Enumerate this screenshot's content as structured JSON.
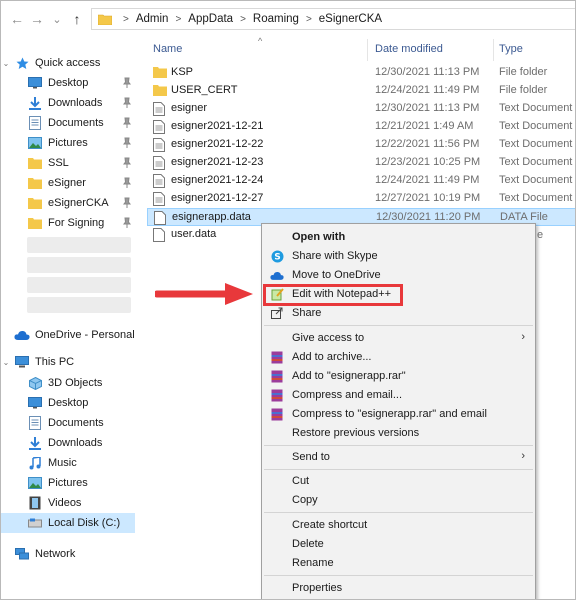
{
  "breadcrumb": [
    "Admin",
    "AppData",
    "Roaming",
    "eSignerCKA"
  ],
  "nav": {
    "back": "←",
    "forward": "→",
    "recent": "⌄",
    "up": "↑"
  },
  "sidebar": {
    "quick_access": "Quick access",
    "pinned": [
      "Desktop",
      "Downloads",
      "Documents",
      "Pictures",
      "SSL",
      "eSigner",
      "eSignerCKA",
      "For Signing"
    ],
    "onedrive": "OneDrive - Personal",
    "this_pc": "This PC",
    "pc_items": [
      "3D Objects",
      "Desktop",
      "Documents",
      "Downloads",
      "Music",
      "Pictures",
      "Videos",
      "Local Disk (C:)"
    ],
    "network": "Network"
  },
  "columns": {
    "name": "Name",
    "date": "Date modified",
    "type": "Type",
    "sort": "^"
  },
  "files": [
    {
      "name": "KSP",
      "date": "12/30/2021 11:13 PM",
      "type": "File folder",
      "icon": "folder-icon"
    },
    {
      "name": "USER_CERT",
      "date": "12/24/2021 11:49 PM",
      "type": "File folder",
      "icon": "folder-icon"
    },
    {
      "name": "esigner",
      "date": "12/30/2021 11:13 PM",
      "type": "Text Document",
      "icon": "document-icon"
    },
    {
      "name": "esigner2021-12-21",
      "date": "12/21/2021 1:49 AM",
      "type": "Text Document",
      "icon": "document-icon"
    },
    {
      "name": "esigner2021-12-22",
      "date": "12/22/2021 11:56 PM",
      "type": "Text Document",
      "icon": "document-icon"
    },
    {
      "name": "esigner2021-12-23",
      "date": "12/23/2021 10:25 PM",
      "type": "Text Document",
      "icon": "document-icon"
    },
    {
      "name": "esigner2021-12-24",
      "date": "12/24/2021 11:49 PM",
      "type": "Text Document",
      "icon": "document-icon"
    },
    {
      "name": "esigner2021-12-27",
      "date": "12/27/2021 10:19 PM",
      "type": "Text Document",
      "icon": "document-icon"
    },
    {
      "name": "esignerapp.data",
      "date": "12/30/2021 11:20 PM",
      "type": "DATA File",
      "icon": "blank-file-icon"
    },
    {
      "name": "user.data",
      "date": "",
      "type": "",
      "icon": "blank-file-icon"
    }
  ],
  "context_menu": {
    "open_with": "Open with",
    "share_skype": "Share with Skype",
    "move_onedrive": "Move to OneDrive",
    "edit_notepad": "Edit with Notepad++",
    "share": "Share",
    "give_access": "Give access to",
    "add_archive": "Add to archive...",
    "add_rar": "Add to \"esignerapp.rar\"",
    "compress_email": "Compress and email...",
    "compress_rar_email": "Compress to \"esignerapp.rar\" and email",
    "restore": "Restore previous versions",
    "send_to": "Send to",
    "cut": "Cut",
    "copy": "Copy",
    "create_shortcut": "Create shortcut",
    "delete": "Delete",
    "rename": "Rename",
    "properties": "Properties",
    "submenu_arrow": "›",
    "user_data_type_tail": "e"
  },
  "colors": {
    "selection": "#cce8ff",
    "annotation": "#e8383b",
    "folder": "#f4c84a",
    "link": "#3c5a92"
  }
}
